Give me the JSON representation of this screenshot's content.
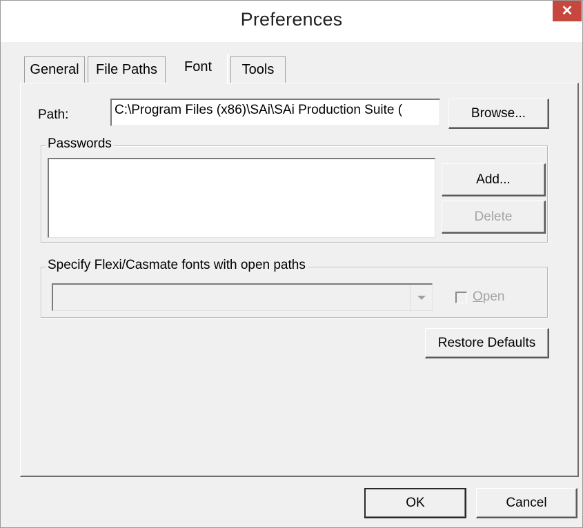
{
  "window": {
    "title": "Preferences",
    "close_symbol": "✕"
  },
  "tabs": [
    {
      "label": "General"
    },
    {
      "label": "File Paths"
    },
    {
      "label": "Font"
    },
    {
      "label": "Tools"
    }
  ],
  "active_tab": "Font",
  "font_tab": {
    "path_label": "Path:",
    "path_value": "C:\\Program Files (x86)\\SAi\\SAi Production Suite (",
    "browse_label": "Browse...",
    "passwords_group": {
      "legend": "Passwords",
      "items": [],
      "add_label": "Add...",
      "delete_label": "Delete"
    },
    "flexi_group": {
      "legend": "Specify Flexi/Casmate fonts with open paths",
      "selected_value": "",
      "open_label_underlined": "O",
      "open_label_rest": "pen",
      "open_checked": false
    },
    "restore_defaults_label": "Restore Defaults"
  },
  "footer": {
    "ok_label": "OK",
    "cancel_label": "Cancel"
  },
  "icons": {
    "close": "close-icon",
    "dropdown": "chevron-down-icon",
    "checkbox": "checkbox-icon"
  },
  "colors": {
    "close_button": "#c7463d",
    "window_bg": "#f0f0f0",
    "disabled_text": "#a3a3a3"
  }
}
